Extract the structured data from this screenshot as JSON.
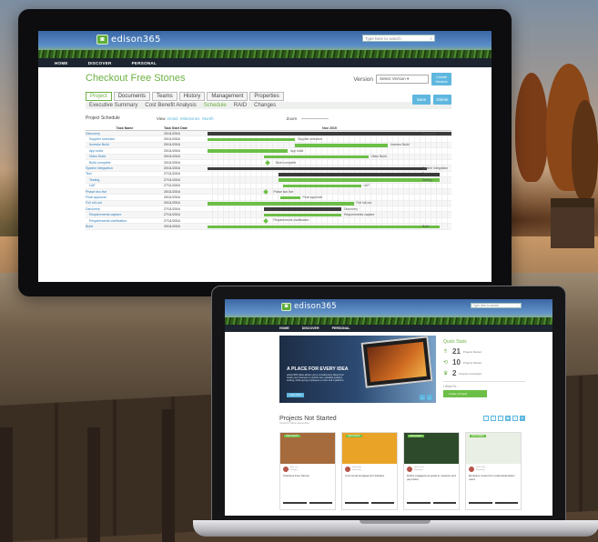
{
  "brand": {
    "logo_text": "edison365",
    "logo_sub": "powered by",
    "logo_badge": "◙"
  },
  "desktop": {
    "search_placeholder": "Type here to search",
    "nav": [
      "HOME",
      "DISCOVER",
      "PERSONAL"
    ],
    "page_title": "Checkout Free Stones",
    "version_label": "Version",
    "version_value": "Select Version",
    "create_version_label": "Create Version",
    "tabs": [
      "Project",
      "Documents",
      "Teams",
      "History",
      "Management",
      "Properties"
    ],
    "subtabs": [
      "Executive Summary",
      "Cost Benefit Analysis",
      "Schedule",
      "RAID",
      "Changes"
    ],
    "buttons": [
      "Save",
      "Delete"
    ],
    "schedule_title": "Project Schedule",
    "view_label": "View",
    "view_options": [
      "Detail",
      "Milestones",
      "Month"
    ],
    "zoom_label": "Zoom",
    "col_task": "Task Name",
    "col_date": "Task Start Date",
    "month_label": "Nov 2015",
    "tasks": [
      {
        "name": "Discovery",
        "date": "20/11/2016",
        "sub": false
      },
      {
        "name": "Supplier selection",
        "date": "20/11/2016",
        "sub": true
      },
      {
        "name": "Investor Build",
        "date": "20/11/2016",
        "sub": true
      },
      {
        "name": "App build",
        "date": "20/11/2016",
        "sub": true
      },
      {
        "name": "Video Build",
        "date": "20/11/2016",
        "sub": true
      },
      {
        "name": "Build complete",
        "date": "20/11/2016",
        "sub": true
      },
      {
        "name": "System Integration",
        "date": "20/11/2016",
        "sub": false
      },
      {
        "name": "Test",
        "date": "27/11/2016",
        "sub": false
      },
      {
        "name": "Testing",
        "date": "27/11/2016",
        "sub": true
      },
      {
        "name": "UAT",
        "date": "27/11/2016",
        "sub": true
      },
      {
        "name": "Phase two live",
        "date": "20/11/2016",
        "sub": false
      },
      {
        "name": "Final approval",
        "date": "20/11/2016",
        "sub": false
      },
      {
        "name": "Full roll-out",
        "date": "20/11/2016",
        "sub": false
      },
      {
        "name": "Discovery",
        "date": "27/11/2016",
        "sub": false
      },
      {
        "name": "Requirements capture",
        "date": "27/11/2016",
        "sub": true
      },
      {
        "name": "Requirements clarification",
        "date": "27/11/2016",
        "sub": true
      },
      {
        "name": "Build",
        "date": "20/11/2016",
        "sub": false
      }
    ],
    "bar_labels": [
      "Discovery",
      "Supplier selection",
      "Investor Build",
      "App build",
      "Video Build",
      "Build complete",
      "System Integration",
      "Test",
      "Testing",
      "UAT",
      "Phase two live",
      "Final approval",
      "Full roll-out",
      "Discovery",
      "Requirements capture",
      "Requirements clarification",
      "Build"
    ]
  },
  "laptop": {
    "search_placeholder": "Type here to search",
    "nav": [
      "HOME",
      "DISCOVER",
      "PERSONAL"
    ],
    "hero_title": "A PLACE FOR EVERY IDEA",
    "hero_text": "edison365 ideas allows you to crowdsource ideas from inside your business to unlock new, valuable problem solving, while giving employees a voice and a platform.",
    "hero_button": "Learn More",
    "quick_title": "Quick Stats",
    "stats": [
      {
        "icon": "rocket-icon",
        "glyph": "⇮",
        "value": "21",
        "label": "Projects Started"
      },
      {
        "icon": "loop-icon",
        "glyph": "⟲",
        "value": "10",
        "label": "Projects Started"
      },
      {
        "icon": "trophy-icon",
        "glyph": "♛",
        "value": "2",
        "label": "Projects Completed"
      }
    ],
    "idea_prompt": "I Want To...",
    "create_project_button": "Create a Project",
    "pns_title": "Projects Not Started",
    "pns_sub": "Sorted by Name descending",
    "cards": [
      {
        "tag": "DISCOVERY",
        "title": "Checkout Free Stones",
        "meta": "Alex Lee\nDesigns",
        "img": "#a66b3c"
      },
      {
        "tag": "DISCOVERY",
        "title": "Community Engagement Initiative",
        "meta": "Nabel Aziz\nMarketing",
        "img": "#e9a326"
      },
      {
        "tag": "DISCOVERY",
        "title": "Define engagement goals to measure and pay better",
        "meta": "Harriet Lee\nMarketing",
        "img": "#2d4a2a"
      },
      {
        "tag": "DISCOVERY",
        "title": "Exclusive content for email subscription users",
        "meta": "Rohit Dilip\nMarketing",
        "img": "#e9efe4"
      }
    ]
  },
  "colors": {
    "brand_green": "#6cbf46",
    "accent_blue": "#5fb7df",
    "nav_dark": "#1d2530"
  }
}
